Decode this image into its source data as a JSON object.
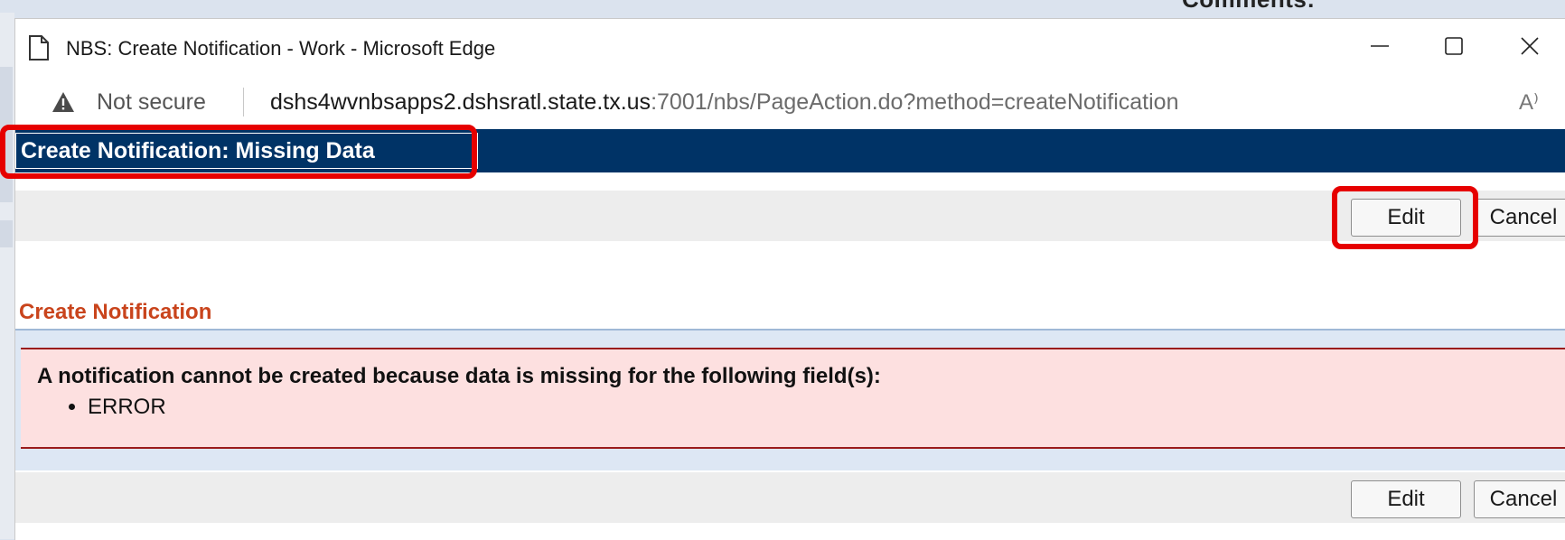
{
  "background": {
    "comments_label": "Comments:"
  },
  "window": {
    "title": "NBS: Create Notification - Work - Microsoft Edge",
    "controls": {
      "minimize_icon": "minimize-icon",
      "maximize_icon": "maximize-icon",
      "close_icon": "close-icon"
    }
  },
  "address_bar": {
    "security_label": "Not secure",
    "url_host": "dshs4wvnbsapps2.dshsratl.state.tx.us",
    "url_path": ":7001/nbs/PageAction.do?method=createNotification",
    "read_aloud_icon": "A⁾"
  },
  "page": {
    "header_title": "Create Notification: Missing Data",
    "toolbar_top": {
      "edit_label": "Edit",
      "cancel_label": "Cancel"
    },
    "section_title": "Create Notification",
    "error": {
      "heading": "A notification cannot be created because data is missing for the following field(s):",
      "items": [
        "ERROR"
      ]
    },
    "toolbar_bottom": {
      "edit_label": "Edit",
      "cancel_label": "Cancel"
    }
  },
  "colors": {
    "header_bg": "#003366",
    "section_title": "#c9441c",
    "error_bg": "#fde0e0",
    "error_border": "#9b1c1c",
    "highlight": "#e60000"
  }
}
